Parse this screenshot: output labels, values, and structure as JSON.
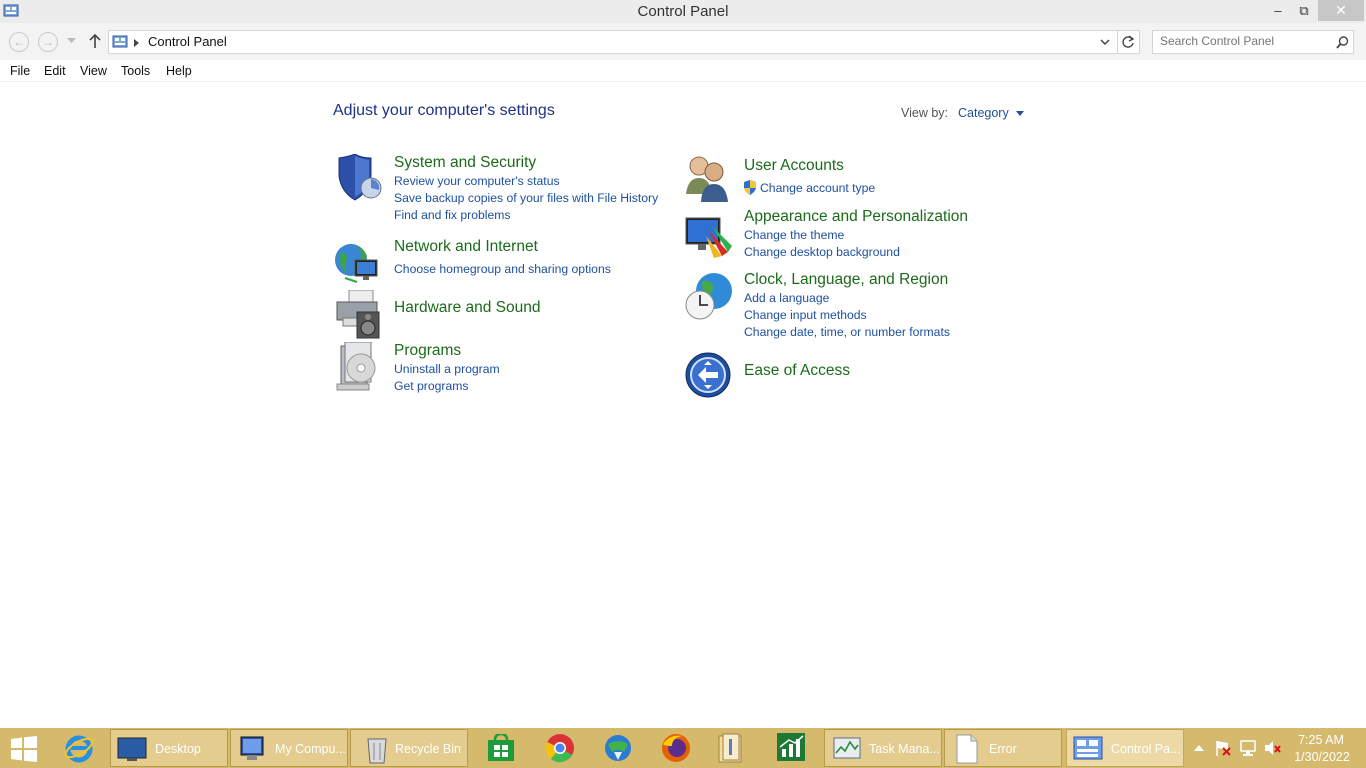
{
  "window": {
    "title": "Control Panel",
    "minimize": "–",
    "restore": "⧉",
    "close": "✕"
  },
  "address": {
    "crumb": "Control Panel",
    "search_placeholder": "Search Control Panel"
  },
  "menu": [
    "File",
    "Edit",
    "View",
    "Tools",
    "Help"
  ],
  "main": {
    "heading": "Adjust your computer's settings",
    "view_by_label": "View by:",
    "view_by_value": "Category",
    "categories": [
      {
        "title": "System and Security",
        "icon": "shield-icon",
        "links": [
          "Review your computer's status",
          "Save backup copies of your files with File History",
          "Find and fix problems"
        ]
      },
      {
        "title": "Network and Internet",
        "icon": "network-globe-icon",
        "links": [
          "Choose homegroup and sharing options"
        ]
      },
      {
        "title": "Hardware and Sound",
        "icon": "printer-speaker-icon",
        "links": []
      },
      {
        "title": "Programs",
        "icon": "programs-disc-icon",
        "links": [
          "Uninstall a program",
          "Get programs"
        ]
      },
      {
        "title": "User Accounts",
        "icon": "users-icon",
        "links": [
          "Change account type"
        ]
      },
      {
        "title": "Appearance and Personalization",
        "icon": "monitor-palette-icon",
        "links": [
          "Change the theme",
          "Change desktop background"
        ]
      },
      {
        "title": "Clock, Language, and Region",
        "icon": "globe-clock-icon",
        "links": [
          "Add a language",
          "Change input methods",
          "Change date, time, or number formats"
        ]
      },
      {
        "title": "Ease of Access",
        "icon": "ease-of-access-icon",
        "links": []
      }
    ]
  },
  "taskbar": {
    "items": [
      {
        "label": "Desktop",
        "icon": "desktop-icon"
      },
      {
        "label": "My Compu...",
        "icon": "computer-icon"
      },
      {
        "label": "Recycle Bin",
        "icon": "recycle-bin-icon"
      },
      {
        "label": "Task Mana...",
        "icon": "task-manager-icon"
      },
      {
        "label": "Error",
        "icon": "document-icon"
      },
      {
        "label": "Control Pa...",
        "icon": "control-panel-icon"
      }
    ],
    "clock_time": "7:25 AM",
    "clock_date": "1/30/2022"
  },
  "colors": {
    "accent_link": "#1e50a2",
    "category_title": "#1b6b1b",
    "taskbar": "#d5b96c"
  }
}
